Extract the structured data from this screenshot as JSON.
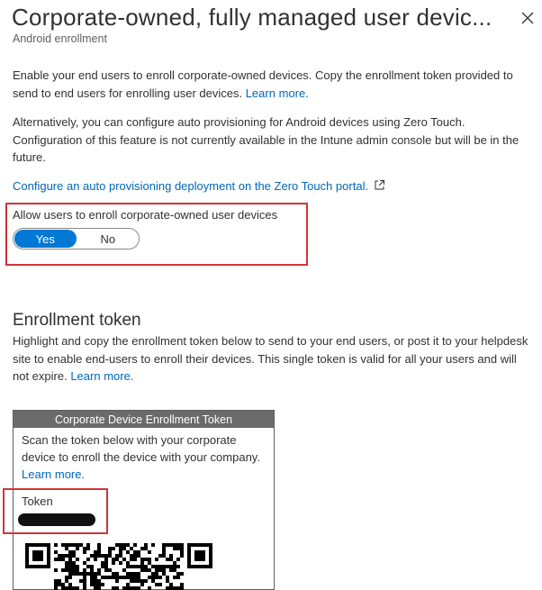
{
  "header": {
    "title": "Corporate-owned, fully managed user devic...",
    "subtitle": "Android enrollment",
    "close_icon": "close-icon"
  },
  "intro": {
    "text": "Enable your end users to enroll corporate-owned devices. Copy the enrollment token provided to send to end users for enrolling user devices. ",
    "link": "Learn more."
  },
  "zero_touch": {
    "text": "Alternatively, you can configure auto provisioning for Android devices using Zero Touch. Configuration of this feature is not currently available in the Intune admin console but will be in the future.",
    "link": "Configure an auto provisioning deployment on the Zero Touch portal.",
    "link_icon": "external-link-icon"
  },
  "allow_toggle": {
    "label": "Allow users to enroll corporate-owned user devices",
    "options": [
      "Yes",
      "No"
    ],
    "selected": "Yes"
  },
  "enrollment_token": {
    "title": "Enrollment token",
    "text": "Highlight and copy the enrollment token below to send to your end users, or post it to your helpdesk site to enable end-users to enroll their devices. This single token is valid for all your users and will not expire. ",
    "link": "Learn more."
  },
  "token_card": {
    "header": "Corporate Device Enrollment Token",
    "description": "Scan the token below with your corporate device to enroll the device with your company. ",
    "link": "Learn more.",
    "token_label": "Token"
  },
  "colors": {
    "accent": "#0078d4",
    "link": "#0067b8",
    "highlight": "#d13438",
    "card_header": "#6b6b6b"
  }
}
